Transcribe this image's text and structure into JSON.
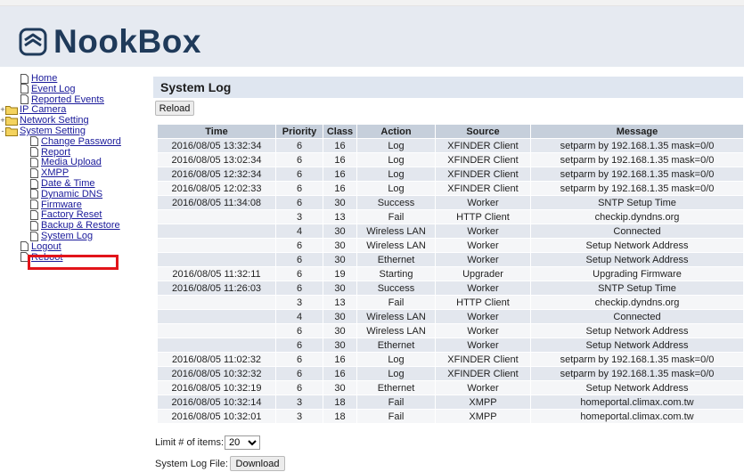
{
  "brand": {
    "name": "NookBox",
    "color": "#1f3a5a"
  },
  "sidebar": {
    "items": [
      {
        "label": "Home",
        "type": "doc",
        "level": 1
      },
      {
        "label": "Event Log",
        "type": "doc",
        "level": 1
      },
      {
        "label": "Reported Events",
        "type": "doc",
        "level": 1
      },
      {
        "label": "IP Camera",
        "type": "folder",
        "level": 0,
        "expander": "+"
      },
      {
        "label": "Network Setting",
        "type": "folder",
        "level": 0,
        "expander": "+"
      },
      {
        "label": "System Setting",
        "type": "folder-open",
        "level": 0,
        "expander": "-"
      },
      {
        "label": "Change Password",
        "type": "doc",
        "level": 2
      },
      {
        "label": "Report",
        "type": "doc",
        "level": 2
      },
      {
        "label": "Media Upload",
        "type": "doc",
        "level": 2
      },
      {
        "label": "XMPP",
        "type": "doc",
        "level": 2
      },
      {
        "label": "Date & Time",
        "type": "doc",
        "level": 2
      },
      {
        "label": "Dynamic DNS",
        "type": "doc",
        "level": 2
      },
      {
        "label": "Firmware",
        "type": "doc",
        "level": 2
      },
      {
        "label": "Factory Reset",
        "type": "doc",
        "level": 2
      },
      {
        "label": "Backup & Restore",
        "type": "doc",
        "level": 2
      },
      {
        "label": "System Log",
        "type": "doc",
        "level": 2,
        "selected": true
      },
      {
        "label": "Logout",
        "type": "doc",
        "level": 1
      },
      {
        "label": "Reboot",
        "type": "doc",
        "level": 1
      }
    ],
    "highlight_color": "#e2141a"
  },
  "main": {
    "title": "System Log",
    "reload_label": "Reload",
    "table": {
      "columns": [
        "Time",
        "Priority",
        "Class",
        "Action",
        "Source",
        "Message"
      ],
      "rows": [
        [
          "2016/08/05 13:32:34",
          "6",
          "16",
          "Log",
          "XFINDER Client",
          "setparm by 192.168.1.35 mask=0/0"
        ],
        [
          "2016/08/05 13:02:34",
          "6",
          "16",
          "Log",
          "XFINDER Client",
          "setparm by 192.168.1.35 mask=0/0"
        ],
        [
          "2016/08/05 12:32:34",
          "6",
          "16",
          "Log",
          "XFINDER Client",
          "setparm by 192.168.1.35 mask=0/0"
        ],
        [
          "2016/08/05 12:02:33",
          "6",
          "16",
          "Log",
          "XFINDER Client",
          "setparm by 192.168.1.35 mask=0/0"
        ],
        [
          "2016/08/05 11:34:08",
          "6",
          "30",
          "Success",
          "Worker",
          "SNTP Setup Time"
        ],
        [
          "",
          "3",
          "13",
          "Fail",
          "HTTP Client",
          "checkip.dyndns.org"
        ],
        [
          "",
          "4",
          "30",
          "Wireless LAN",
          "Worker",
          "Connected"
        ],
        [
          "",
          "6",
          "30",
          "Wireless LAN",
          "Worker",
          "Setup Network Address"
        ],
        [
          "",
          "6",
          "30",
          "Ethernet",
          "Worker",
          "Setup Network Address"
        ],
        [
          "2016/08/05 11:32:11",
          "6",
          "19",
          "Starting",
          "Upgrader",
          "Upgrading Firmware"
        ],
        [
          "2016/08/05 11:26:03",
          "6",
          "30",
          "Success",
          "Worker",
          "SNTP Setup Time"
        ],
        [
          "",
          "3",
          "13",
          "Fail",
          "HTTP Client",
          "checkip.dyndns.org"
        ],
        [
          "",
          "4",
          "30",
          "Wireless LAN",
          "Worker",
          "Connected"
        ],
        [
          "",
          "6",
          "30",
          "Wireless LAN",
          "Worker",
          "Setup Network Address"
        ],
        [
          "",
          "6",
          "30",
          "Ethernet",
          "Worker",
          "Setup Network Address"
        ],
        [
          "2016/08/05 11:02:32",
          "6",
          "16",
          "Log",
          "XFINDER Client",
          "setparm by 192.168.1.35 mask=0/0"
        ],
        [
          "2016/08/05 10:32:32",
          "6",
          "16",
          "Log",
          "XFINDER Client",
          "setparm by 192.168.1.35 mask=0/0"
        ],
        [
          "2016/08/05 10:32:19",
          "6",
          "30",
          "Ethernet",
          "Worker",
          "Setup Network Address"
        ],
        [
          "2016/08/05 10:32:14",
          "3",
          "18",
          "Fail",
          "XMPP",
          "homeportal.climax.com.tw"
        ],
        [
          "2016/08/05 10:32:01",
          "3",
          "18",
          "Fail",
          "XMPP",
          "homeportal.climax.com.tw"
        ]
      ]
    },
    "limit_label": "Limit # of items:",
    "limit_value": "20",
    "log_file_label": "System Log File:",
    "download_label": "Download"
  },
  "colors": {
    "header_bg": "#e6eaf1",
    "table_header_bg": "#c6cfdb",
    "row_odd": "#e3e7ee",
    "row_even": "#f5f6f8",
    "link": "#1a1a9a"
  }
}
